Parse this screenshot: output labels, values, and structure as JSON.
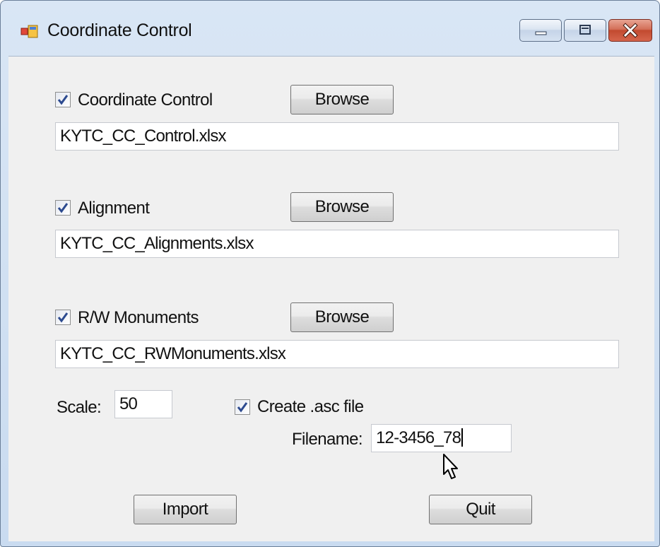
{
  "window": {
    "title": "Coordinate Control"
  },
  "sections": [
    {
      "checkbox_label": "Coordinate Control",
      "checked": true,
      "browse_label": "Browse",
      "file_value": "KYTC_CC_Control.xlsx"
    },
    {
      "checkbox_label": "Alignment",
      "checked": true,
      "browse_label": "Browse",
      "file_value": "KYTC_CC_Alignments.xlsx"
    },
    {
      "checkbox_label": "R/W Monuments",
      "checked": true,
      "browse_label": "Browse",
      "file_value": "KYTC_CC_RWMonuments.xlsx"
    }
  ],
  "scale": {
    "label": "Scale:",
    "value": "50"
  },
  "asc": {
    "checkbox_label": "Create .asc file",
    "checked": true,
    "filename_label": "Filename:",
    "filename_value": "12-3456_78"
  },
  "buttons": {
    "import_label": "Import",
    "quit_label": "Quit"
  },
  "icons": {
    "app": "app-window-icon",
    "minimize": "minimize-icon",
    "maximize": "maximize-icon",
    "close": "close-icon",
    "check": "checkmark-icon",
    "cursor": "mouse-pointer-icon"
  }
}
